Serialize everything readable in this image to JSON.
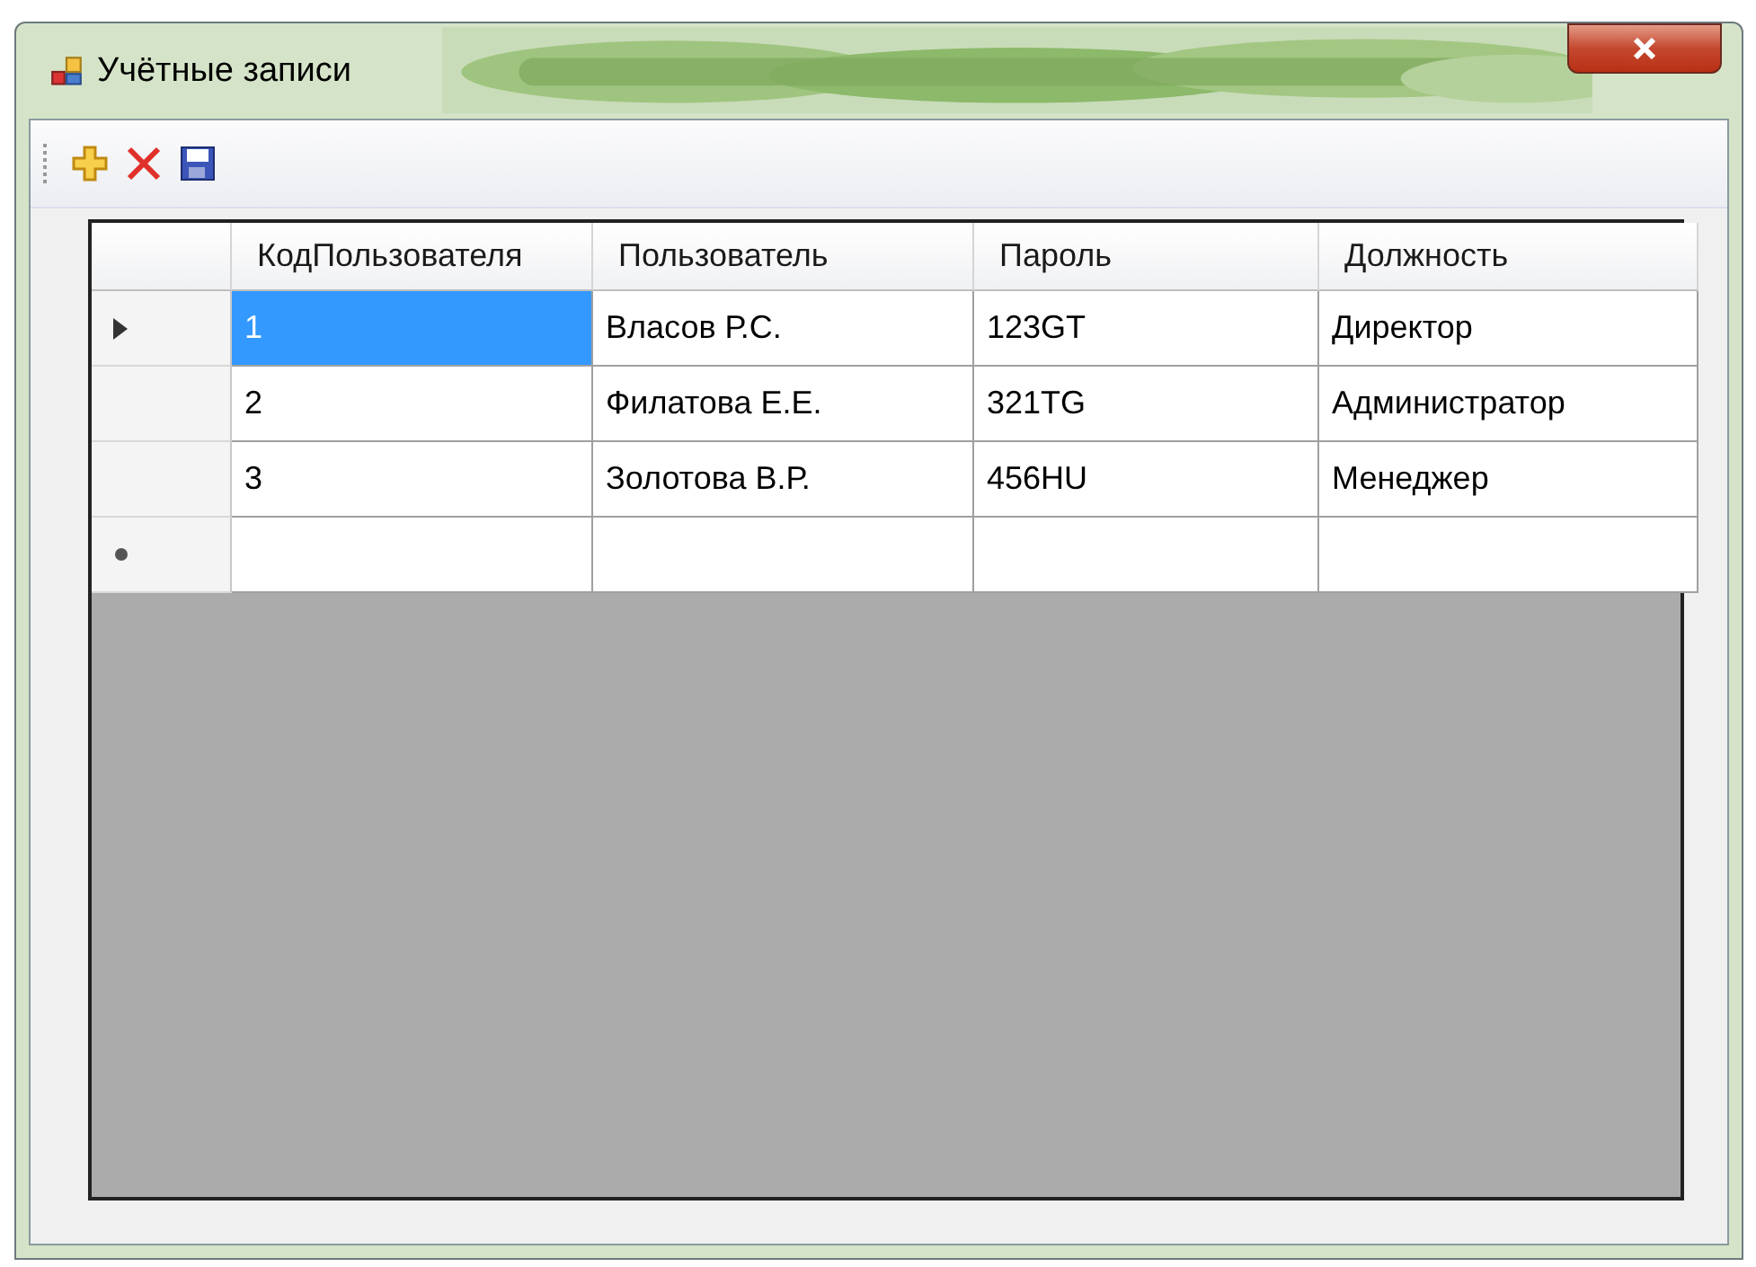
{
  "window": {
    "title": "Учётные записи"
  },
  "toolbar": {
    "buttons": [
      {
        "kind": "add"
      },
      {
        "kind": "delete"
      },
      {
        "kind": "save"
      }
    ]
  },
  "table": {
    "columns": [
      "КодПользователя",
      "Пользователь",
      "Пароль",
      "Должность"
    ],
    "rows": [
      {
        "kind": "data",
        "current": true,
        "cells": [
          {
            "text": "1",
            "selected": true
          },
          {
            "text": "Власов Р.С.",
            "selected": false
          },
          {
            "text": "123GT",
            "selected": false
          },
          {
            "text": "Директор",
            "selected": false
          }
        ]
      },
      {
        "kind": "data",
        "current": false,
        "cells": [
          {
            "text": "2",
            "selected": false
          },
          {
            "text": "Филатова Е.Е.",
            "selected": false
          },
          {
            "text": "321TG",
            "selected": false
          },
          {
            "text": "Администратор",
            "selected": false
          }
        ]
      },
      {
        "kind": "data",
        "current": false,
        "cells": [
          {
            "text": "3",
            "selected": false
          },
          {
            "text": "Золотова В.Р.",
            "selected": false
          },
          {
            "text": "456HU",
            "selected": false
          },
          {
            "text": "Менеджер",
            "selected": false
          }
        ]
      },
      {
        "kind": "new",
        "current": false,
        "cells": []
      }
    ]
  }
}
